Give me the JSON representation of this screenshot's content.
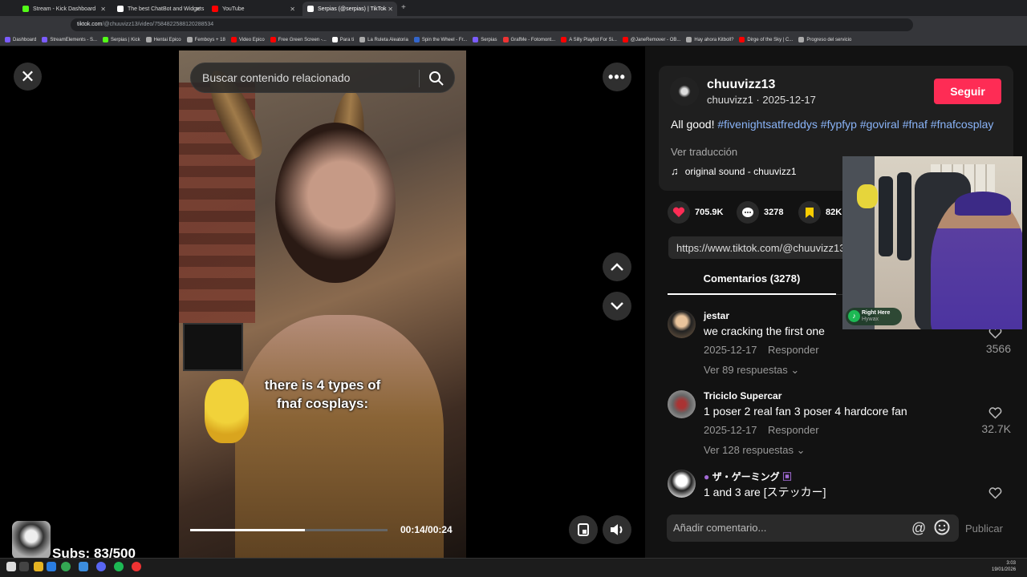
{
  "browser": {
    "tabs": [
      {
        "label": "Stream - Kick Dashboard",
        "color": "#53fc18"
      },
      {
        "label": "The best ChatBot and Widgets",
        "color": "#ffffff"
      },
      {
        "label": "YouTube",
        "color": "#ff0000"
      },
      {
        "label": "Serpias (@serpias) | TikTok",
        "color": "#ffffff"
      }
    ],
    "url_domain": "tiktok.com",
    "url_path": "/@chuuvizz13/video/7584822588120288534",
    "bookmarks": [
      "Dashboard",
      "StreamElements - S...",
      "Serpias | Kick",
      "Hentai Epico",
      "Femboys + 18",
      "Video Epico",
      "Free Green Screen -...",
      "Para ti",
      "La Ruleta Aleatoria",
      "Spin the Wheel - Fr...",
      "Serpias",
      "GrafMe - Fotomont...",
      "A Silly Playlist For Si...",
      "@JaneRemover - OB...",
      "Hay ahora Kitboll?",
      "Dirge of the Sky | C...",
      "Progreso del servicio"
    ]
  },
  "video": {
    "search_placeholder": "Buscar contenido relacionado",
    "caption_line1": "there is 4 types of",
    "caption_line2": "fnaf cosplays:",
    "time": "00:14/00:24",
    "progress": 0.58
  },
  "post": {
    "username": "chuuvizz13",
    "handle_date": "chuuvizz1 · 2025-12-17",
    "follow_label": "Seguir",
    "desc_text": "All good! ",
    "hashtags": [
      "#fivenightsatfreddys",
      "#fypfyp",
      "#goviral",
      "#fnaf",
      "#fnafcosplay"
    ],
    "translate_label": "Ver traducción",
    "sound": "original sound - chuuvizz1",
    "likes": "705.9K",
    "comments": "3278",
    "saves": "82K",
    "link": "https://www.tiktok.com/@chuuvizz13",
    "comments_tab": "Comentarios (3278)"
  },
  "comments": [
    {
      "user": "jestar",
      "text": "we cracking the first one",
      "date": "2025-12-17",
      "reply": "Responder",
      "more": "Ver 89 respuestas",
      "likes": "3566"
    },
    {
      "user": "Triciclo Supercar",
      "text": "1 poser 2 real fan 3 poser 4 hardcore fan",
      "date": "2025-12-17",
      "reply": "Responder",
      "more": "Ver 128 respuestas",
      "likes": "32.7K"
    },
    {
      "user": "ザ・ゲーミング",
      "text": "1 and 3 are [ステッカー]",
      "date": "",
      "reply": "",
      "more": "",
      "likes": ""
    }
  ],
  "composer": {
    "placeholder": "Añadir comentario...",
    "publish": "Publicar"
  },
  "overlay": {
    "subs": "Subs: 83/500",
    "music_title": "Right Here",
    "music_artist": "Hywax"
  },
  "clock": {
    "time": "3:03",
    "date": "19/01/2026"
  },
  "colors": {
    "accent": "#fe2c55",
    "hashtag": "#8ab4f8"
  }
}
